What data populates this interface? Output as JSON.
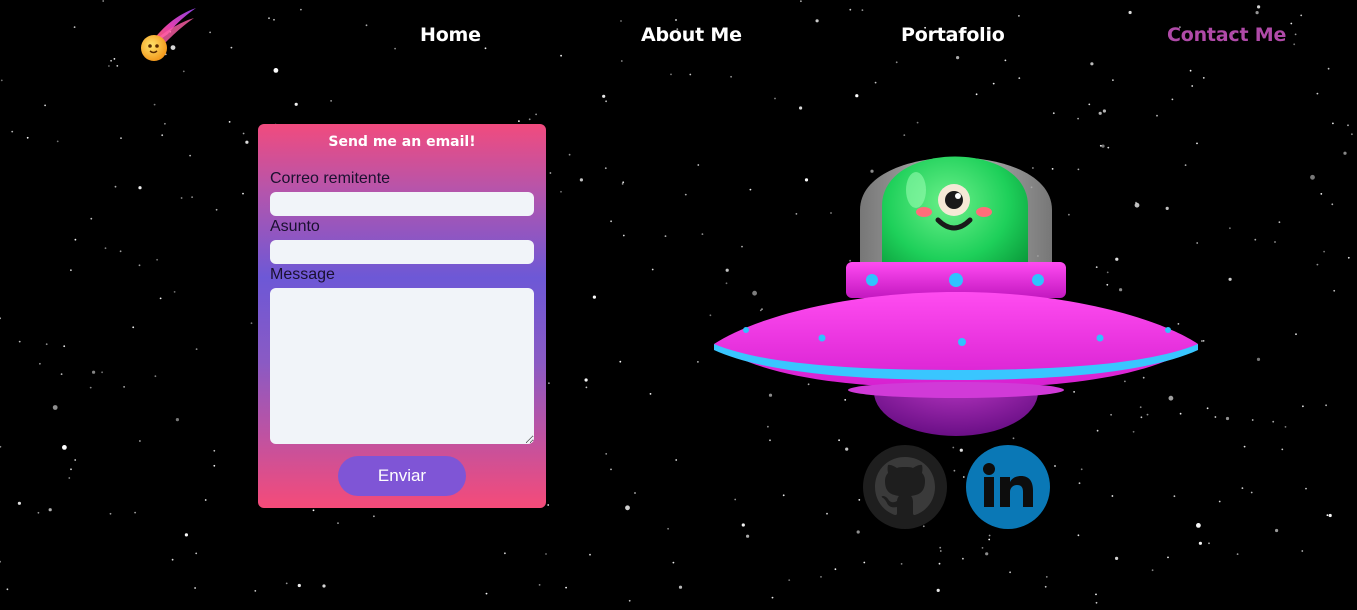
{
  "nav": {
    "logo_icon": "comet-logo-icon",
    "items": [
      {
        "label": "Home"
      },
      {
        "label": "About Me"
      },
      {
        "label": "Portafolio"
      },
      {
        "label": "Contact Me",
        "active": true
      }
    ],
    "active_color": "#b04aa8"
  },
  "form": {
    "title": "Send me an email!",
    "fields": {
      "sender_label": "Correo remitente",
      "sender_value": "",
      "subject_label": "Asunto",
      "subject_value": "",
      "message_label": "Message",
      "message_value": ""
    },
    "submit_label": "Enviar",
    "colors": {
      "gradient_top": "#f14b7e",
      "gradient_mid": "#6d58d6",
      "button": "#7f55d6"
    }
  },
  "illustration": {
    "icon": "ufo-alien-icon"
  },
  "social": [
    {
      "icon": "github-icon"
    },
    {
      "icon": "linkedin-icon"
    }
  ],
  "theme": {
    "background": "#000000",
    "text": "#ffffff"
  }
}
